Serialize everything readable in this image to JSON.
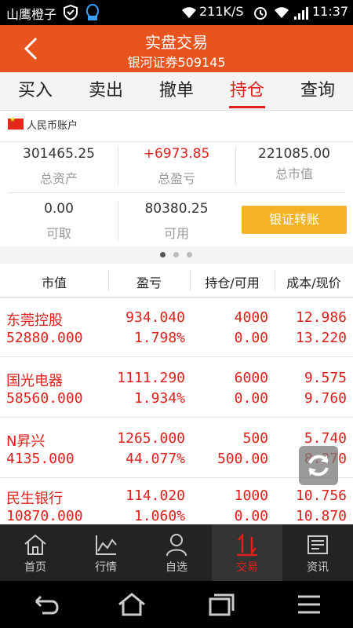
{
  "status_bar": {
    "carrier": "山鹰橙子",
    "speed": "211K/S",
    "time": "11:37"
  },
  "header": {
    "title": "实盘交易",
    "subtitle": "银河证券509145"
  },
  "tabs": [
    "买入",
    "卖出",
    "撤单",
    "持仓",
    "查询"
  ],
  "active_tab": "持仓",
  "account": {
    "label": "人民币账户",
    "summary": [
      {
        "value": "301465.25",
        "label": "总资产"
      },
      {
        "value": "+6973.85",
        "label": "总盈亏"
      },
      {
        "value": "221085.00",
        "label": "总市值"
      },
      {
        "value": "0.00",
        "label": "可取"
      },
      {
        "value": "80380.25",
        "label": "可用"
      }
    ],
    "transfer_button": "银证转账"
  },
  "pager": {
    "count": 3,
    "active": 0
  },
  "table": {
    "headers": [
      "市值",
      "盈亏",
      "持仓/可用",
      "成本/现价"
    ],
    "rows": [
      {
        "name": "东莞控股",
        "market_value": "52880.000",
        "profit": "934.040",
        "profit_pct": "1.798%",
        "holding": "4000",
        "available": "0.00",
        "cost": "12.986",
        "price": "13.220"
      },
      {
        "name": "国光电器",
        "market_value": "58560.000",
        "profit": "1111.290",
        "profit_pct": "1.934%",
        "holding": "6000",
        "available": "0.00",
        "cost": "9.575",
        "price": "9.760"
      },
      {
        "name": "N昇兴",
        "market_value": "4135.000",
        "profit": "1265.000",
        "profit_pct": "44.077%",
        "holding": "500",
        "available": "500.00",
        "cost": "5.740",
        "price": "8.270"
      },
      {
        "name": "民生银行",
        "market_value": "10870.000",
        "profit": "114.020",
        "profit_pct": "1.060%",
        "holding": "1000",
        "available": "0.00",
        "cost": "10.756",
        "price": "10.870"
      }
    ]
  },
  "bottom_nav": [
    {
      "label": "首页",
      "icon": "home-icon"
    },
    {
      "label": "行情",
      "icon": "chart-icon"
    },
    {
      "label": "自选",
      "icon": "person-icon"
    },
    {
      "label": "交易",
      "icon": "trade-icon"
    },
    {
      "label": "资讯",
      "icon": "news-icon"
    }
  ],
  "active_nav": "交易",
  "colors": {
    "header": "#e9541e",
    "accent": "#e0201a",
    "button": "#f3b325"
  }
}
